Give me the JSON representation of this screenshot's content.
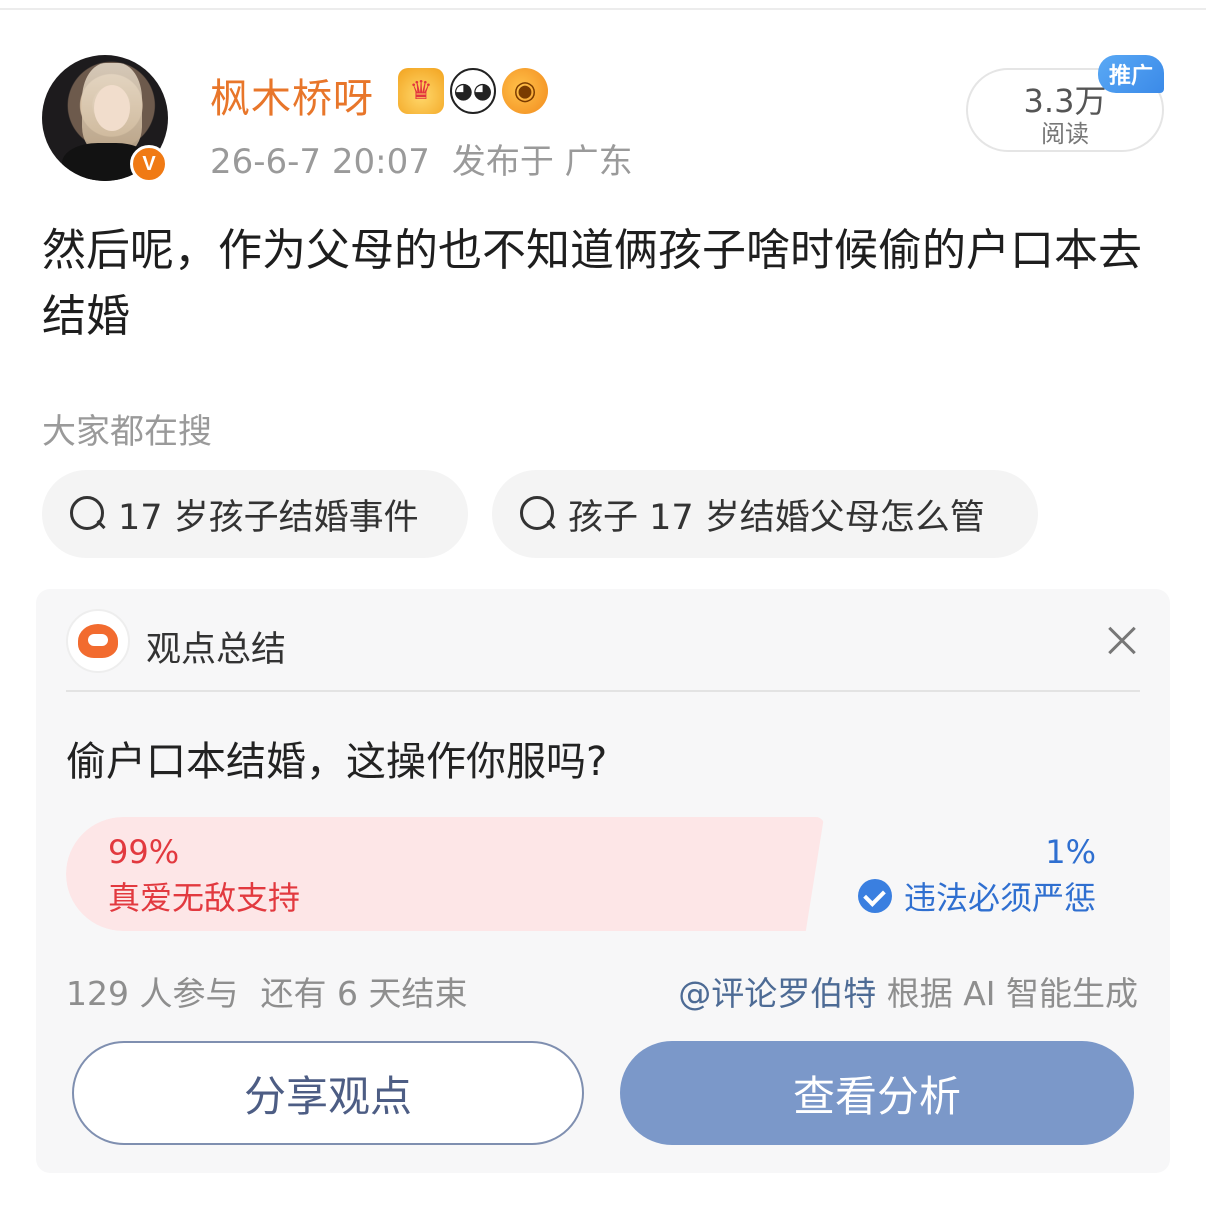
{
  "post": {
    "username": "枫木桥呀",
    "timestamp": "26-6-7 20:07",
    "location": "发布于 广东",
    "verified_badge": "V",
    "emoji_badges": [
      "crown-icon",
      "panda-icon",
      "pufferfish-icon"
    ],
    "reads": {
      "count": "3.3万",
      "label": "阅读"
    },
    "promo_tag": "推广",
    "text": "然后呢，作为父母的也不知道俩孩子啥时候偷的户口本去结婚"
  },
  "search": {
    "title": "大家都在搜",
    "chips": [
      "17 岁孩子结婚事件",
      "孩子 17 岁结婚父母怎么管"
    ]
  },
  "summary_card": {
    "title": "观点总结",
    "question": "偷户口本结婚，这操作你服吗?",
    "options": [
      {
        "percent": "99%",
        "label": "真爱无敌支持",
        "share": 0.99,
        "color": "#e2393f"
      },
      {
        "percent": "1%",
        "label": "违法必须严惩",
        "share": 0.01,
        "color": "#2f6fd0",
        "selected": true
      }
    ],
    "participants": "129 人参与",
    "remaining": "还有 6 天结束",
    "credit_account": "@评论罗伯特",
    "credit_note": "根据 AI 智能生成",
    "share_button": "分享观点",
    "analyze_button": "查看分析"
  }
}
